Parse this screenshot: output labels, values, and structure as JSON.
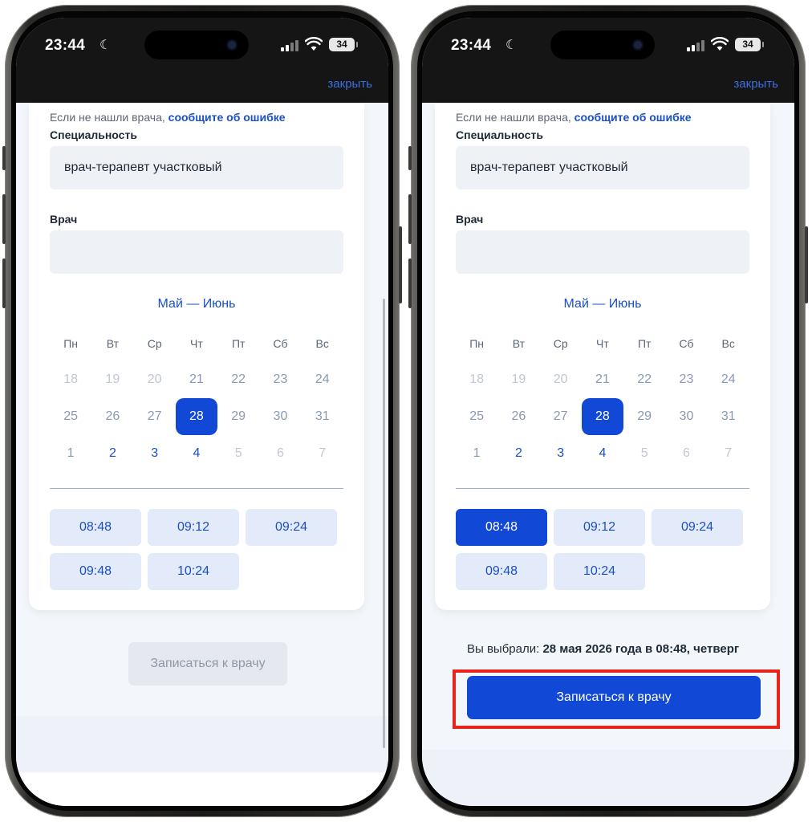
{
  "status": {
    "time": "23:44",
    "battery": "34"
  },
  "nav": {
    "close_label": "закрыть"
  },
  "form": {
    "hint_prefix": "Если не нашли врача,",
    "hint_link": "сообщите об ошибке",
    "specialty_label": "Специальность",
    "specialty_value": "врач-терапевт участковый",
    "doctor_label": "Врач",
    "doctor_value": ""
  },
  "calendar": {
    "title": "Май — Июнь",
    "weekdays": [
      "Пн",
      "Вт",
      "Ср",
      "Чт",
      "Пт",
      "Сб",
      "Вс"
    ],
    "weeks": [
      [
        {
          "d": "18",
          "s": "off"
        },
        {
          "d": "19",
          "s": "off"
        },
        {
          "d": "20",
          "s": "off"
        },
        {
          "d": "21",
          "s": "past"
        },
        {
          "d": "22",
          "s": "past"
        },
        {
          "d": "23",
          "s": "past"
        },
        {
          "d": "24",
          "s": "past"
        }
      ],
      [
        {
          "d": "25",
          "s": "past"
        },
        {
          "d": "26",
          "s": "past"
        },
        {
          "d": "27",
          "s": "past"
        },
        {
          "d": "28",
          "s": "sel"
        },
        {
          "d": "29",
          "s": "past"
        },
        {
          "d": "30",
          "s": "past"
        },
        {
          "d": "31",
          "s": "past"
        }
      ],
      [
        {
          "d": "1",
          "s": "past"
        },
        {
          "d": "2",
          "s": "avail"
        },
        {
          "d": "3",
          "s": "avail"
        },
        {
          "d": "4",
          "s": "avail"
        },
        {
          "d": "5",
          "s": "off"
        },
        {
          "d": "6",
          "s": "off"
        },
        {
          "d": "7",
          "s": "off"
        }
      ]
    ]
  },
  "slots": [
    "08:48",
    "09:12",
    "09:24",
    "09:48",
    "10:24"
  ],
  "selection": {
    "prefix": "Вы выбрали:",
    "value": "28 мая 2026 года в 08:48, четверг",
    "active_slot": "08:48"
  },
  "submit": {
    "label": "Записаться к врачу"
  },
  "colors": {
    "accent": "#1248d6",
    "link": "#1a4fc6",
    "highlight": "#e8251d"
  }
}
